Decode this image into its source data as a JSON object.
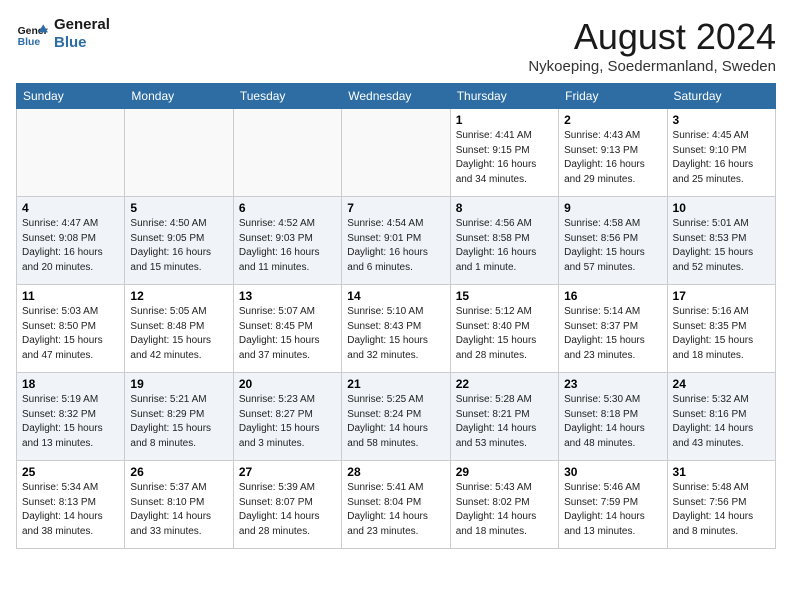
{
  "header": {
    "logo_line1": "General",
    "logo_line2": "Blue",
    "month_year": "August 2024",
    "location": "Nykoeping, Soedermanland, Sweden"
  },
  "weekdays": [
    "Sunday",
    "Monday",
    "Tuesday",
    "Wednesday",
    "Thursday",
    "Friday",
    "Saturday"
  ],
  "weeks": [
    [
      {
        "day": "",
        "info": ""
      },
      {
        "day": "",
        "info": ""
      },
      {
        "day": "",
        "info": ""
      },
      {
        "day": "",
        "info": ""
      },
      {
        "day": "1",
        "info": "Sunrise: 4:41 AM\nSunset: 9:15 PM\nDaylight: 16 hours\nand 34 minutes."
      },
      {
        "day": "2",
        "info": "Sunrise: 4:43 AM\nSunset: 9:13 PM\nDaylight: 16 hours\nand 29 minutes."
      },
      {
        "day": "3",
        "info": "Sunrise: 4:45 AM\nSunset: 9:10 PM\nDaylight: 16 hours\nand 25 minutes."
      }
    ],
    [
      {
        "day": "4",
        "info": "Sunrise: 4:47 AM\nSunset: 9:08 PM\nDaylight: 16 hours\nand 20 minutes."
      },
      {
        "day": "5",
        "info": "Sunrise: 4:50 AM\nSunset: 9:05 PM\nDaylight: 16 hours\nand 15 minutes."
      },
      {
        "day": "6",
        "info": "Sunrise: 4:52 AM\nSunset: 9:03 PM\nDaylight: 16 hours\nand 11 minutes."
      },
      {
        "day": "7",
        "info": "Sunrise: 4:54 AM\nSunset: 9:01 PM\nDaylight: 16 hours\nand 6 minutes."
      },
      {
        "day": "8",
        "info": "Sunrise: 4:56 AM\nSunset: 8:58 PM\nDaylight: 16 hours\nand 1 minute."
      },
      {
        "day": "9",
        "info": "Sunrise: 4:58 AM\nSunset: 8:56 PM\nDaylight: 15 hours\nand 57 minutes."
      },
      {
        "day": "10",
        "info": "Sunrise: 5:01 AM\nSunset: 8:53 PM\nDaylight: 15 hours\nand 52 minutes."
      }
    ],
    [
      {
        "day": "11",
        "info": "Sunrise: 5:03 AM\nSunset: 8:50 PM\nDaylight: 15 hours\nand 47 minutes."
      },
      {
        "day": "12",
        "info": "Sunrise: 5:05 AM\nSunset: 8:48 PM\nDaylight: 15 hours\nand 42 minutes."
      },
      {
        "day": "13",
        "info": "Sunrise: 5:07 AM\nSunset: 8:45 PM\nDaylight: 15 hours\nand 37 minutes."
      },
      {
        "day": "14",
        "info": "Sunrise: 5:10 AM\nSunset: 8:43 PM\nDaylight: 15 hours\nand 32 minutes."
      },
      {
        "day": "15",
        "info": "Sunrise: 5:12 AM\nSunset: 8:40 PM\nDaylight: 15 hours\nand 28 minutes."
      },
      {
        "day": "16",
        "info": "Sunrise: 5:14 AM\nSunset: 8:37 PM\nDaylight: 15 hours\nand 23 minutes."
      },
      {
        "day": "17",
        "info": "Sunrise: 5:16 AM\nSunset: 8:35 PM\nDaylight: 15 hours\nand 18 minutes."
      }
    ],
    [
      {
        "day": "18",
        "info": "Sunrise: 5:19 AM\nSunset: 8:32 PM\nDaylight: 15 hours\nand 13 minutes."
      },
      {
        "day": "19",
        "info": "Sunrise: 5:21 AM\nSunset: 8:29 PM\nDaylight: 15 hours\nand 8 minutes."
      },
      {
        "day": "20",
        "info": "Sunrise: 5:23 AM\nSunset: 8:27 PM\nDaylight: 15 hours\nand 3 minutes."
      },
      {
        "day": "21",
        "info": "Sunrise: 5:25 AM\nSunset: 8:24 PM\nDaylight: 14 hours\nand 58 minutes."
      },
      {
        "day": "22",
        "info": "Sunrise: 5:28 AM\nSunset: 8:21 PM\nDaylight: 14 hours\nand 53 minutes."
      },
      {
        "day": "23",
        "info": "Sunrise: 5:30 AM\nSunset: 8:18 PM\nDaylight: 14 hours\nand 48 minutes."
      },
      {
        "day": "24",
        "info": "Sunrise: 5:32 AM\nSunset: 8:16 PM\nDaylight: 14 hours\nand 43 minutes."
      }
    ],
    [
      {
        "day": "25",
        "info": "Sunrise: 5:34 AM\nSunset: 8:13 PM\nDaylight: 14 hours\nand 38 minutes."
      },
      {
        "day": "26",
        "info": "Sunrise: 5:37 AM\nSunset: 8:10 PM\nDaylight: 14 hours\nand 33 minutes."
      },
      {
        "day": "27",
        "info": "Sunrise: 5:39 AM\nSunset: 8:07 PM\nDaylight: 14 hours\nand 28 minutes."
      },
      {
        "day": "28",
        "info": "Sunrise: 5:41 AM\nSunset: 8:04 PM\nDaylight: 14 hours\nand 23 minutes."
      },
      {
        "day": "29",
        "info": "Sunrise: 5:43 AM\nSunset: 8:02 PM\nDaylight: 14 hours\nand 18 minutes."
      },
      {
        "day": "30",
        "info": "Sunrise: 5:46 AM\nSunset: 7:59 PM\nDaylight: 14 hours\nand 13 minutes."
      },
      {
        "day": "31",
        "info": "Sunrise: 5:48 AM\nSunset: 7:56 PM\nDaylight: 14 hours\nand 8 minutes."
      }
    ]
  ]
}
